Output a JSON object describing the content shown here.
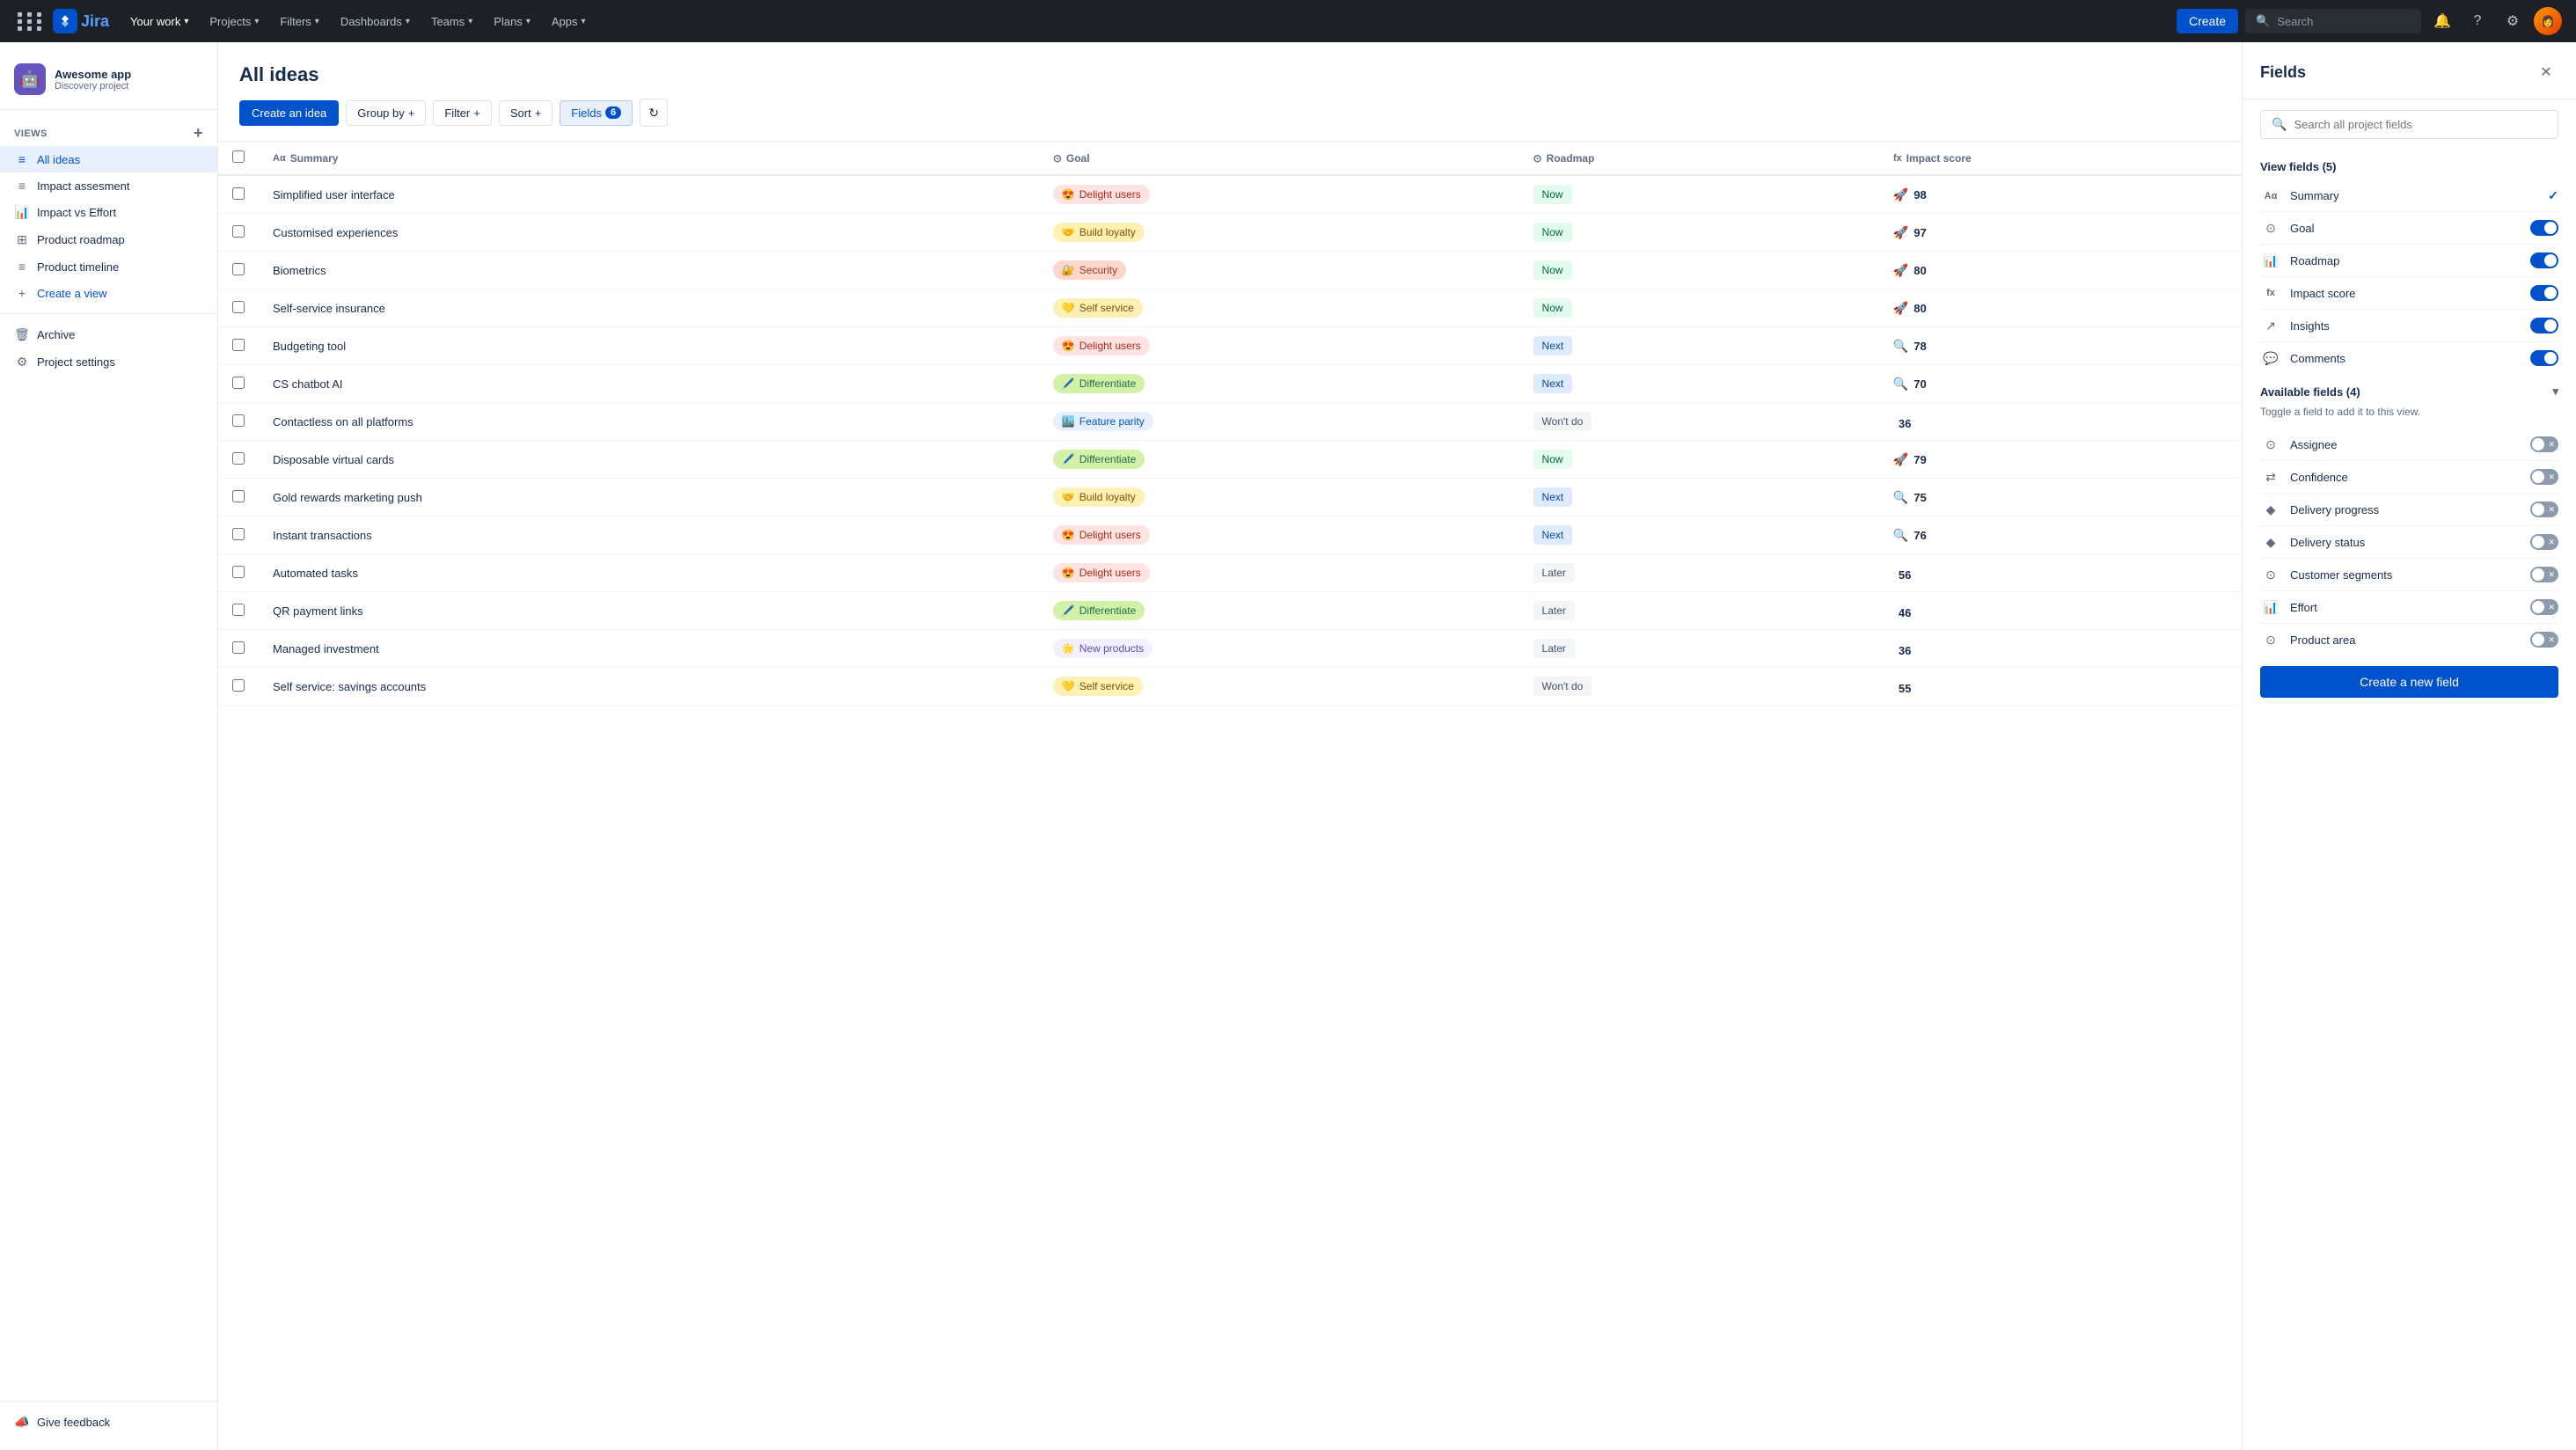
{
  "nav": {
    "logo_text": "Jira",
    "items": [
      {
        "label": "Your work",
        "has_dropdown": true
      },
      {
        "label": "Projects",
        "has_dropdown": true
      },
      {
        "label": "Filters",
        "has_dropdown": true
      },
      {
        "label": "Dashboards",
        "has_dropdown": true
      },
      {
        "label": "Teams",
        "has_dropdown": true
      },
      {
        "label": "Plans",
        "has_dropdown": true
      },
      {
        "label": "Apps",
        "has_dropdown": true
      }
    ],
    "create_label": "Create",
    "search_placeholder": "Search"
  },
  "sidebar": {
    "project_name": "Awesome app",
    "project_type": "Discovery project",
    "views_label": "VIEWS",
    "views": [
      {
        "label": "All ideas",
        "icon": "≡",
        "active": true
      },
      {
        "label": "Impact assesment",
        "icon": "≡"
      },
      {
        "label": "Impact vs Effort",
        "icon": "📊"
      },
      {
        "label": "Product roadmap",
        "icon": "⊞"
      },
      {
        "label": "Product timeline",
        "icon": "≡"
      },
      {
        "label": "Create a view",
        "icon": "+"
      }
    ],
    "archive_label": "Archive",
    "settings_label": "Project settings",
    "feedback_label": "Give feedback"
  },
  "main": {
    "title": "All ideas",
    "toolbar": {
      "create_label": "Create an idea",
      "group_label": "Group by",
      "filter_label": "Filter",
      "sort_label": "Sort",
      "fields_label": "Fields",
      "fields_count": "6"
    },
    "columns": [
      "Summary",
      "Goal",
      "Roadmap",
      "Impact score"
    ],
    "rows": [
      {
        "summary": "Simplified user interface",
        "goal": "Delight users",
        "goal_type": "delight",
        "goal_emoji": "😍",
        "roadmap": "Now",
        "roadmap_type": "now",
        "impact": 98,
        "impact_emoji": "🚀"
      },
      {
        "summary": "Customised experiences",
        "goal": "Build loyalty",
        "goal_type": "loyalty",
        "goal_emoji": "🤝",
        "roadmap": "Now",
        "roadmap_type": "now",
        "impact": 97,
        "impact_emoji": "🚀"
      },
      {
        "summary": "Biometrics",
        "goal": "Security",
        "goal_type": "security",
        "goal_emoji": "🔐",
        "roadmap": "Now",
        "roadmap_type": "now",
        "impact": 80,
        "impact_emoji": "🚀"
      },
      {
        "summary": "Self-service insurance",
        "goal": "Self service",
        "goal_type": "selfservice",
        "goal_emoji": "💛",
        "roadmap": "Now",
        "roadmap_type": "now",
        "impact": 80,
        "impact_emoji": "🚀"
      },
      {
        "summary": "Budgeting tool",
        "goal": "Delight users",
        "goal_type": "delight",
        "goal_emoji": "😍",
        "roadmap": "Next",
        "roadmap_type": "next",
        "impact": 78,
        "impact_emoji": "🔍"
      },
      {
        "summary": "CS chatbot AI",
        "goal": "Differentiate",
        "goal_type": "differentiate",
        "goal_emoji": "🖊️",
        "roadmap": "Next",
        "roadmap_type": "next",
        "impact": 70,
        "impact_emoji": "🔍"
      },
      {
        "summary": "Contactless on all platforms",
        "goal": "Feature parity",
        "goal_type": "featureparity",
        "goal_emoji": "🏙️",
        "roadmap": "Won't do",
        "roadmap_type": "wontdo",
        "impact": 36,
        "impact_emoji": ""
      },
      {
        "summary": "Disposable virtual cards",
        "goal": "Differentiate",
        "goal_type": "differentiate",
        "goal_emoji": "🖊️",
        "roadmap": "Now",
        "roadmap_type": "now",
        "impact": 79,
        "impact_emoji": "🚀"
      },
      {
        "summary": "Gold rewards marketing push",
        "goal": "Build loyalty",
        "goal_type": "loyalty",
        "goal_emoji": "🤝",
        "roadmap": "Next",
        "roadmap_type": "next",
        "impact": 75,
        "impact_emoji": "🔍"
      },
      {
        "summary": "Instant transactions",
        "goal": "Delight users",
        "goal_type": "delight",
        "goal_emoji": "😍",
        "roadmap": "Next",
        "roadmap_type": "next",
        "impact": 76,
        "impact_emoji": "🔍"
      },
      {
        "summary": "Automated tasks",
        "goal": "Delight users",
        "goal_type": "delight",
        "goal_emoji": "😍",
        "roadmap": "Later",
        "roadmap_type": "later",
        "impact": 56,
        "impact_emoji": ""
      },
      {
        "summary": "QR payment links",
        "goal": "Differentiate",
        "goal_type": "differentiate",
        "goal_emoji": "🖊️",
        "roadmap": "Later",
        "roadmap_type": "later",
        "impact": 46,
        "impact_emoji": ""
      },
      {
        "summary": "Managed investment",
        "goal": "New products",
        "goal_type": "newproducts",
        "goal_emoji": "🌟",
        "roadmap": "Later",
        "roadmap_type": "later",
        "impact": 36,
        "impact_emoji": ""
      },
      {
        "summary": "Self service: savings accounts",
        "goal": "Self service",
        "goal_type": "selfservice",
        "goal_emoji": "💛",
        "roadmap": "Won't do",
        "roadmap_type": "wontdo",
        "impact": 55,
        "impact_emoji": ""
      }
    ]
  },
  "fields_panel": {
    "title": "Fields",
    "search_placeholder": "Search all project fields",
    "view_fields_title": "View fields (5)",
    "view_fields": [
      {
        "name": "Summary",
        "icon": "Aα",
        "enabled": true,
        "check": true
      },
      {
        "name": "Goal",
        "icon": "⊙",
        "enabled": true
      },
      {
        "name": "Roadmap",
        "icon": "📊",
        "enabled": true
      },
      {
        "name": "Impact score",
        "icon": "fx",
        "enabled": true
      },
      {
        "name": "Insights",
        "icon": "↗",
        "enabled": true
      },
      {
        "name": "Comments",
        "icon": "⊙",
        "enabled": true
      }
    ],
    "available_fields_title": "Available fields (4)",
    "available_note": "Toggle a field to add it to this view.",
    "available_fields": [
      {
        "name": "Assignee",
        "icon": "⊙"
      },
      {
        "name": "Confidence",
        "icon": "⇄"
      },
      {
        "name": "Delivery progress",
        "icon": "◆"
      },
      {
        "name": "Delivery status",
        "icon": "◆"
      },
      {
        "name": "Customer segments",
        "icon": "⊙"
      },
      {
        "name": "Effort",
        "icon": "📊"
      },
      {
        "name": "Product area",
        "icon": "⊙"
      }
    ],
    "create_field_label": "Create a new field"
  }
}
